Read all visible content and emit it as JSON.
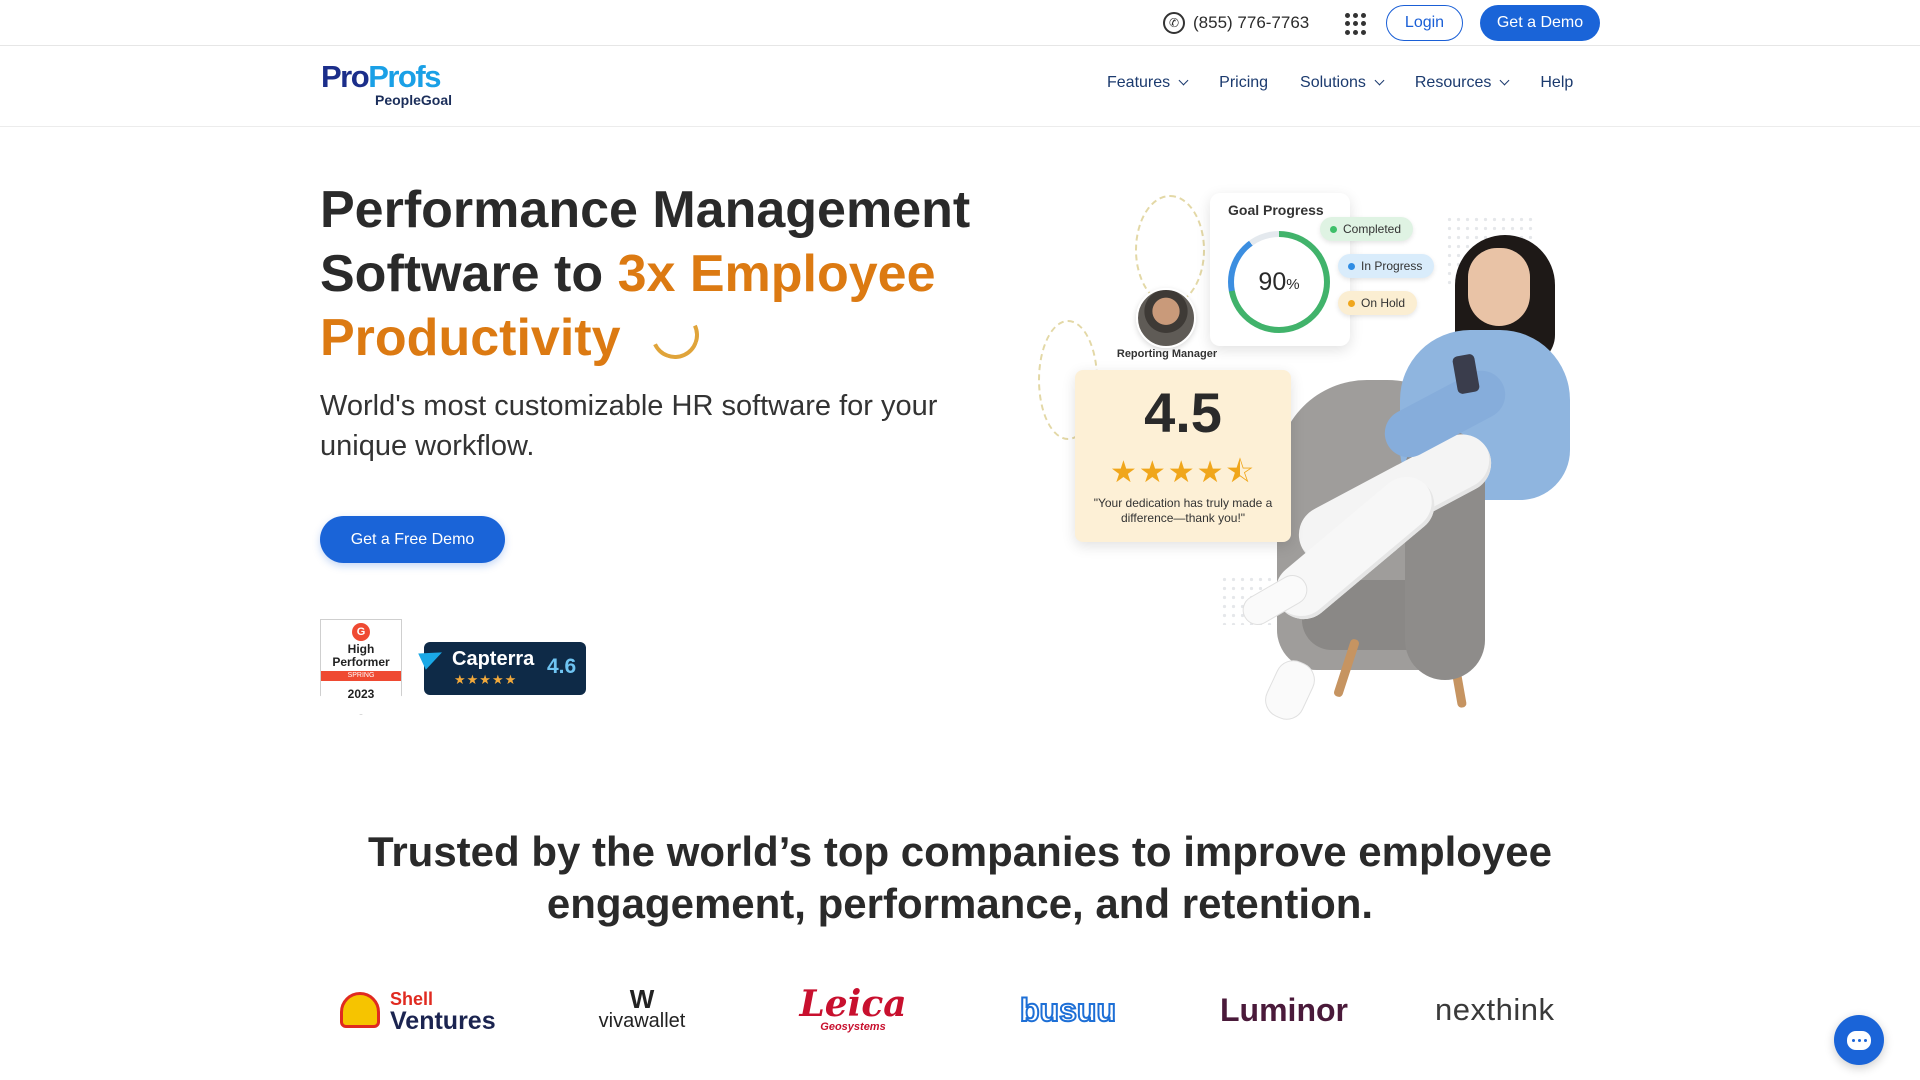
{
  "topbar": {
    "phone": "(855) 776-7763",
    "login_label": "Login",
    "demo_label": "Get a Demo"
  },
  "brand": {
    "logo_main_pro": "Pro",
    "logo_main_profs": "Profs",
    "logo_sub": "PeopleGoal"
  },
  "nav": {
    "items": [
      {
        "label": "Features",
        "has_dropdown": true
      },
      {
        "label": "Pricing",
        "has_dropdown": false
      },
      {
        "label": "Solutions",
        "has_dropdown": true
      },
      {
        "label": "Resources",
        "has_dropdown": true
      },
      {
        "label": "Help",
        "has_dropdown": false
      }
    ]
  },
  "hero": {
    "title_line1": "Performance Management",
    "title_line2_plain": "Software to ",
    "title_line2_accent": "3x Employee",
    "title_line3_accent": "Productivity",
    "subtitle": "World's most customizable HR software for your unique workflow.",
    "cta_label": "Get a Free Demo"
  },
  "badges": {
    "g2": {
      "logo": "G",
      "line1": "High",
      "line2": "Performer",
      "ribbon": "SPRING",
      "year": "2023"
    },
    "capterra": {
      "name": "Capterra",
      "stars": "★★★★★",
      "score": "4.6"
    }
  },
  "illustration": {
    "goal_card": {
      "title": "Goal Progress",
      "percent_value": "90",
      "percent_sign": "%"
    },
    "status_pills": [
      {
        "label": "Completed",
        "color": "#3fbf6a"
      },
      {
        "label": "In Progress",
        "color": "#2f8de4"
      },
      {
        "label": "On Hold",
        "color": "#f0a61b"
      }
    ],
    "manager_label": "Reporting Manager",
    "rating": {
      "score": "4.5",
      "stars": "★★★★⯪",
      "quote": "\"Your dedication has truly made a difference—thank you!\""
    }
  },
  "trusted": {
    "title": "Trusted by the world’s top companies to improve employee engagement, performance, and retention."
  },
  "logos": {
    "shell_line1": "Shell",
    "shell_line2": "Ventures",
    "viva_mark": "W",
    "viva": "vivawallet",
    "leica": "Leica",
    "leica_sub": "Geosystems",
    "busuu": "busuu",
    "luminor": "Luminor",
    "nexthink": "nexthink"
  },
  "colors": {
    "primary": "#1a64d8",
    "accent": "#dc7a12",
    "nav_text": "#1b3a6e"
  }
}
